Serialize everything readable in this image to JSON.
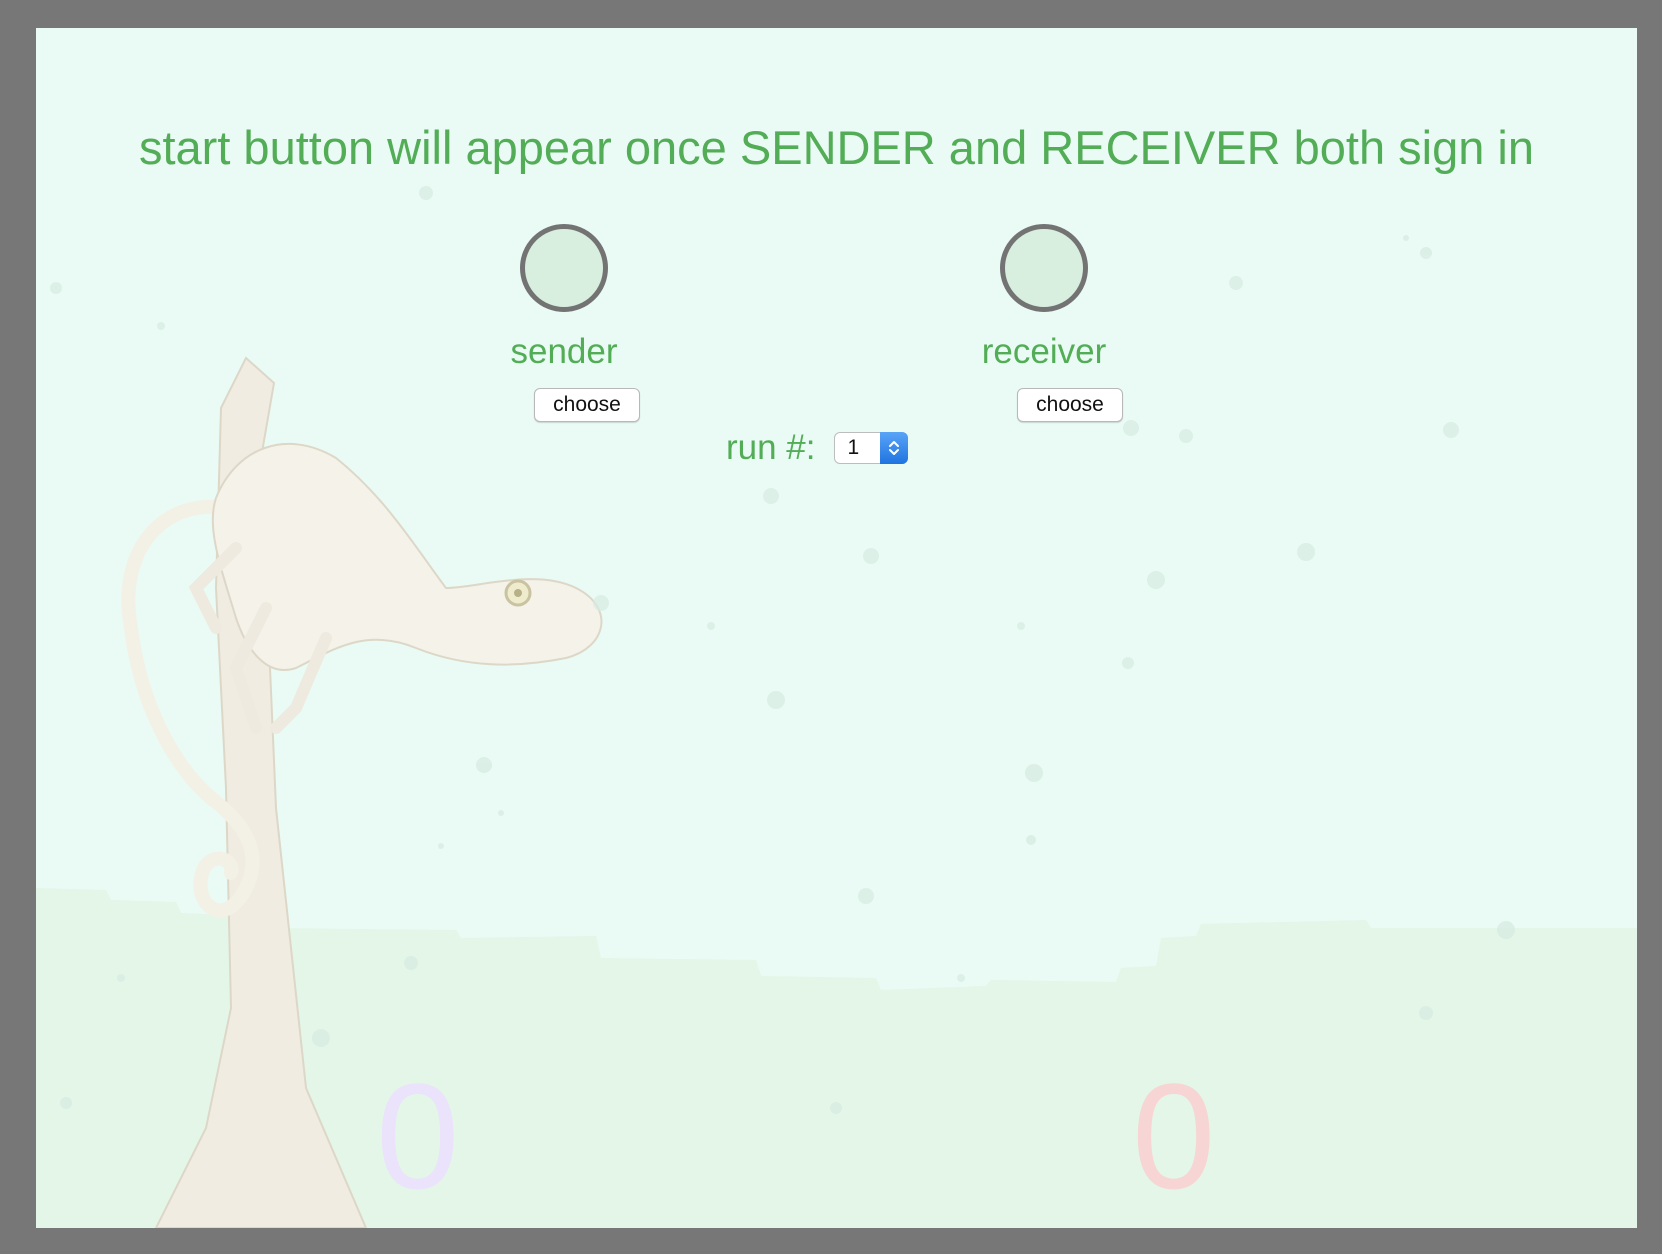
{
  "header": {
    "message": "start button will appear once SENDER and RECEIVER both sign in"
  },
  "players": {
    "sender": {
      "label": "sender",
      "button_label": "choose",
      "score": "0"
    },
    "receiver": {
      "label": "receiver",
      "button_label": "choose",
      "score": "0"
    }
  },
  "run": {
    "label": "run #:",
    "selected": "1"
  },
  "colors": {
    "text_green": "#52ad56",
    "background": "#e9fbf4",
    "frame": "#777777",
    "sender_score": "#ebe2fb",
    "receiver_score": "#f6d5d4"
  },
  "decorations": {
    "background_image": "chameleon-on-branch"
  }
}
